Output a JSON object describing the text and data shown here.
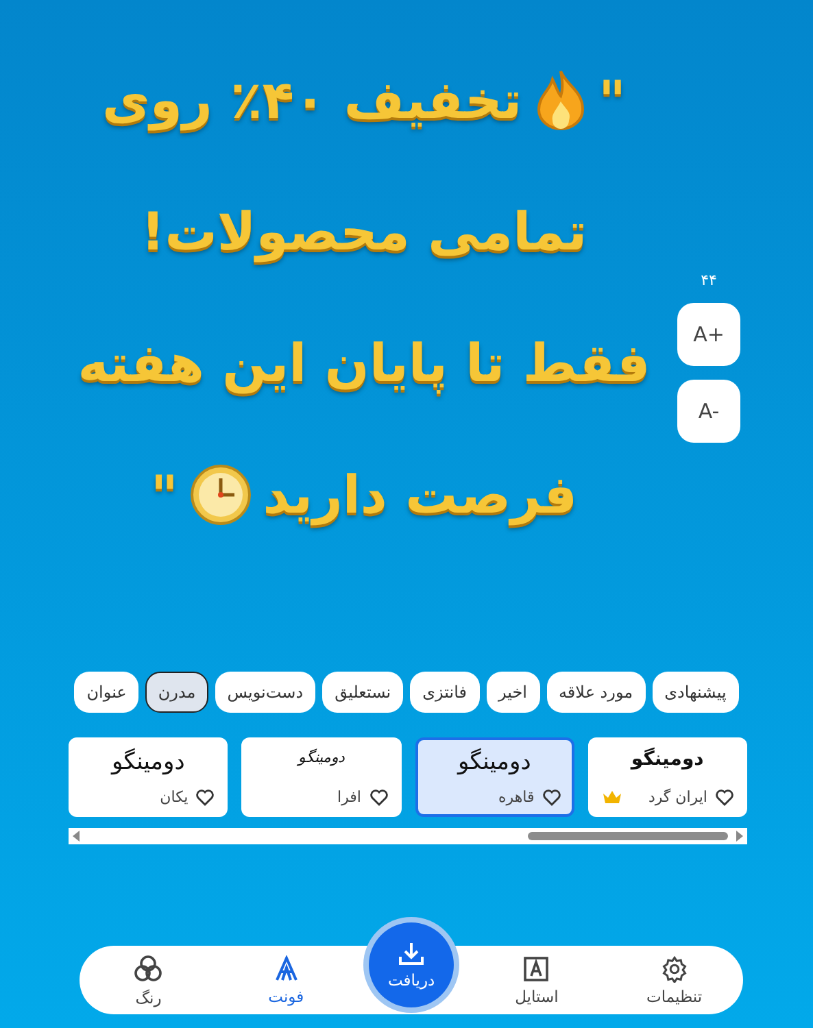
{
  "banner": {
    "lines": [
      [
        {
          "kind": "text",
          "text": "\""
        },
        {
          "kind": "flame"
        },
        {
          "kind": "text",
          "text": "تخفیف ۴۰٪ روی"
        }
      ],
      [
        {
          "kind": "text",
          "text": "تمامی محصولات!"
        }
      ],
      [
        {
          "kind": "text",
          "text": "فقط تا پایان این هفته"
        }
      ],
      [
        {
          "kind": "text",
          "text": "فرصت دارید"
        },
        {
          "kind": "clock"
        },
        {
          "kind": "text",
          "text": "\""
        }
      ]
    ]
  },
  "size_control": {
    "value": "۴۴",
    "increase": "A+",
    "decrease": "A-"
  },
  "categories": [
    {
      "label": "پیشنهادی",
      "selected": false
    },
    {
      "label": "مورد علاقه",
      "selected": false
    },
    {
      "label": "اخیر",
      "selected": false
    },
    {
      "label": "فانتزی",
      "selected": false
    },
    {
      "label": "نستعلیق",
      "selected": false
    },
    {
      "label": "دست‌نویس",
      "selected": false
    },
    {
      "label": "مدرن",
      "selected": true
    },
    {
      "label": "عنوان",
      "selected": false
    }
  ],
  "fonts": [
    {
      "sample": "دومینگو",
      "name": "ایران گرد",
      "kind": "bold",
      "premium": true,
      "liked": false,
      "selected": false
    },
    {
      "sample": "دومینگو",
      "name": "قاهره",
      "kind": "large",
      "premium": false,
      "liked": false,
      "selected": true
    },
    {
      "sample": "دومینگو",
      "name": "افرا",
      "kind": "script",
      "premium": false,
      "liked": false,
      "selected": false
    },
    {
      "sample": "دومینگو",
      "name": "یکان",
      "kind": "large",
      "premium": false,
      "liked": false,
      "selected": false
    }
  ],
  "nav": [
    {
      "label": "تنظیمات",
      "kind": "settings",
      "selected": false
    },
    {
      "label": "استایل",
      "kind": "style",
      "selected": false
    },
    {
      "label": "دریافت",
      "kind": "download",
      "selected": false
    },
    {
      "label": "فونت",
      "kind": "font",
      "selected": true
    },
    {
      "label": "رنگ",
      "kind": "color",
      "selected": false
    }
  ]
}
